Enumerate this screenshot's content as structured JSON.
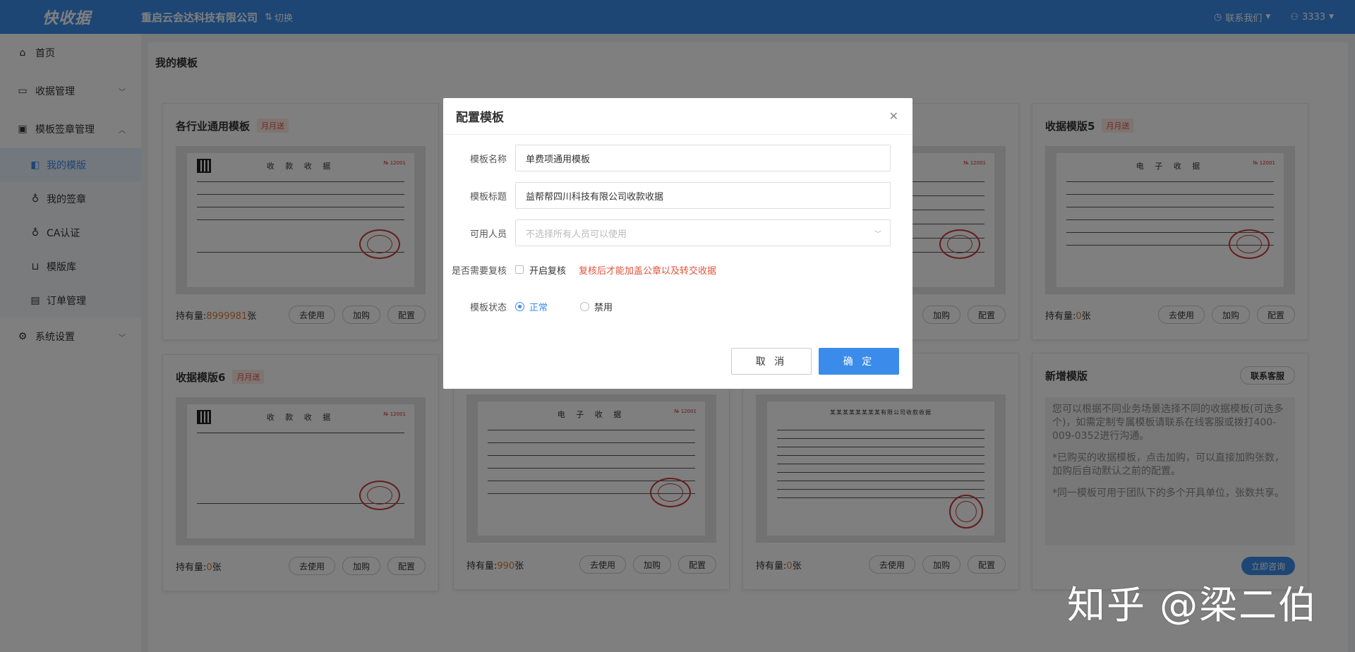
{
  "header": {
    "logo_text": "快收据",
    "company": "重启云会达科技有限公司",
    "switch_label": "切换",
    "contact_label": "联系我们",
    "user_label": "3333"
  },
  "sidebar": {
    "items": [
      {
        "label": "首页"
      },
      {
        "label": "收据管理"
      },
      {
        "label": "模板签章管理"
      },
      {
        "label": "系统设置"
      }
    ],
    "sub_items": [
      {
        "label": "我的模版"
      },
      {
        "label": "我的签章"
      },
      {
        "label": "CA认证"
      },
      {
        "label": "模版库"
      },
      {
        "label": "订单管理"
      }
    ]
  },
  "main": {
    "title": "我的模板",
    "hold_prefix": "持有量:",
    "hold_suffix": "张",
    "btn_use": "去使用",
    "btn_buy": "加购",
    "btn_config": "配置",
    "tag_label": "月月送",
    "cards": [
      {
        "title": "各行业通用模板",
        "hold": "8999981",
        "r_title": "收 款 收 据"
      },
      {
        "title": "收据模版5",
        "hold": "0",
        "r_title": "电 子 收 据"
      },
      {
        "title": "收据模版6",
        "hold": "0",
        "r_title": "收 款 收 据"
      },
      {
        "title": "",
        "hold": "990",
        "r_title": "电 子 收 据"
      },
      {
        "title": "",
        "hold": "0",
        "r_title": "某某某某某某某某有限公司收款收据"
      }
    ],
    "receipt_no": "№ 12001",
    "new_template": {
      "title": "新增模版",
      "kefu_label": "联系客服",
      "paragraphs": [
        "您可以根据不同业务场景选择不同的收据模板(可选多个)，如需定制专属模板请联系在线客服或拨打400-009-0352进行沟通。",
        "*已购买的收据模板，点击加购，可以直接加购张数，加购后自动默认之前的配置。",
        "*同一模板可用于团队下的多个开具单位，张数共享。"
      ],
      "consult_label": "立即咨询"
    }
  },
  "modal": {
    "title": "配置模板",
    "name_label": "模板名称",
    "name_value": "单费项通用模板",
    "title_label": "模板标题",
    "title_value": "益帮帮四川科技有限公司收款收据",
    "users_label": "可用人员",
    "users_placeholder": "不选择所有人员可以使用",
    "review_label": "是否需要复核",
    "review_checkbox": "开启复核",
    "review_warn": "复核后才能加盖公章以及转交收据",
    "status_label": "模板状态",
    "status_normal": "正常",
    "status_disabled": "禁用",
    "cancel_label": "取 消",
    "ok_label": "确 定"
  },
  "watermark": "知乎 @梁二伯"
}
